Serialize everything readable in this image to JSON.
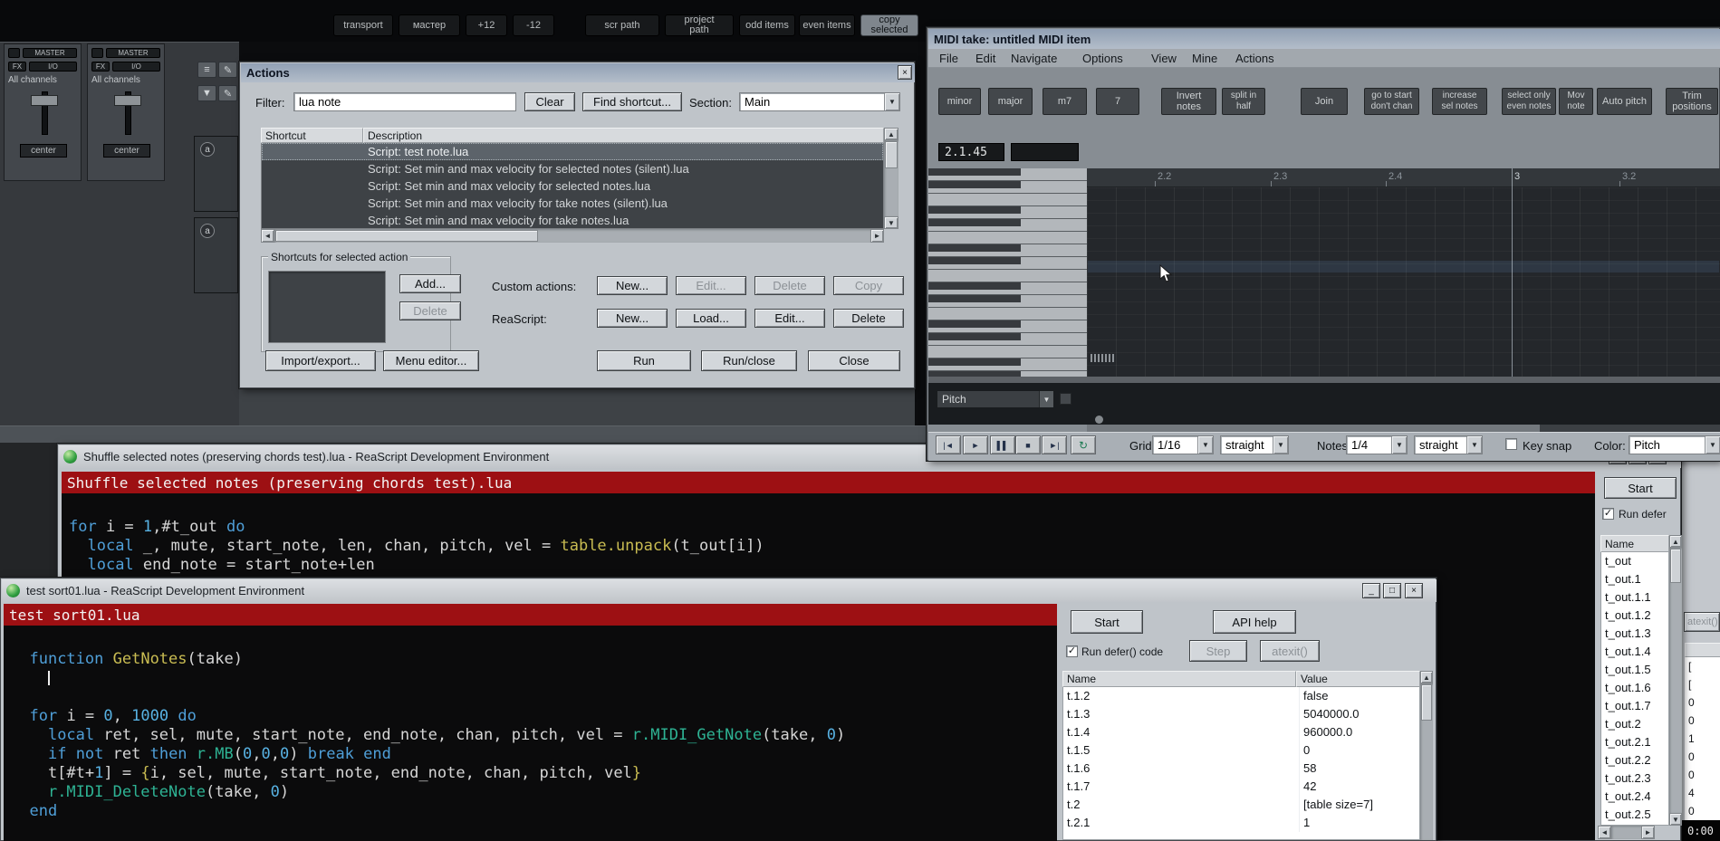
{
  "glyphs": {
    "up": "▲",
    "down": "▼",
    "left": "◄",
    "right": "►",
    "dd": "▼",
    "check": "✓",
    "min": "_",
    "max": "□",
    "close": "×"
  },
  "clock": "0:00",
  "main_toolbar": {
    "buttons": [
      {
        "l1": "transport",
        "l2": ""
      },
      {
        "l1": "мастер",
        "l2": ""
      },
      {
        "l1": "+12",
        "l2": ""
      },
      {
        "l1": "-12",
        "l2": ""
      },
      {
        "l1": "scr path",
        "l2": ""
      },
      {
        "l1": "project",
        "l2": "path"
      },
      {
        "l1": "odd items",
        "l2": ""
      },
      {
        "l1": "even items",
        "l2": ""
      },
      {
        "l1": "copy",
        "l2": "selected"
      }
    ]
  },
  "mixer": {
    "master_label": "MASTER",
    "fx_label": "FX",
    "io_label": "I/O",
    "channels_label": "All channels",
    "pan_label": "center",
    "track_badge": "a"
  },
  "docker_icons": {
    "list": "≡",
    "pencil": "✎",
    "filter": "▼"
  },
  "actions_dialog": {
    "title": "Actions",
    "filter_label": "Filter:",
    "filter_value": "lua note",
    "clear_button": "Clear",
    "find_shortcut_button": "Find shortcut...",
    "section_label": "Section:",
    "section_value": "Main",
    "col_shortcut": "Shortcut",
    "col_description": "Description",
    "rows": [
      "Script: test note.lua",
      "Script: Set min and max velocity for selected notes (silent).lua",
      "Script: Set min and max velocity for selected notes.lua",
      "Script: Set min and max velocity for take notes (silent).lua",
      "Script: Set min and max velocity for take notes.lua"
    ],
    "group_label": "Shortcuts for selected action",
    "add_button": "Add...",
    "delete_button": "Delete",
    "custom_label": "Custom actions:",
    "custom_new": "New...",
    "custom_edit": "Edit...",
    "custom_delete": "Delete",
    "custom_copy": "Copy",
    "reascript_label": "ReaScript:",
    "rs_new": "New...",
    "rs_load": "Load...",
    "rs_edit": "Edit...",
    "rs_delete": "Delete",
    "import_export": "Import/export...",
    "menu_editor": "Menu editor...",
    "run": "Run",
    "run_close": "Run/close",
    "close": "Close"
  },
  "midi_editor": {
    "title": "MIDI take: untitled MIDI item",
    "menus": [
      "File",
      "Edit",
      "Navigate",
      "Options",
      "View",
      "Mine",
      "Actions"
    ],
    "toolbar": [
      {
        "l1": "minor",
        "l2": ""
      },
      {
        "l1": "major",
        "l2": ""
      },
      {
        "l1": "m7",
        "l2": ""
      },
      {
        "l1": "7",
        "l2": ""
      },
      {
        "l1": "Invert",
        "l2": "notes"
      },
      {
        "l1": "split in half",
        "l2": ""
      },
      {
        "l1": "Join",
        "l2": ""
      },
      {
        "l1": "go to start",
        "l2": "don't chan"
      },
      {
        "l1": "increase",
        "l2": "sel notes"
      },
      {
        "l1": "select only",
        "l2": "even notes"
      },
      {
        "l1": "Mov note",
        "l2": ""
      },
      {
        "l1": "Auto pitch",
        "l2": ""
      },
      {
        "l1": "Trim",
        "l2": "positions"
      }
    ],
    "position": "2.1.45",
    "ruler": [
      "2.2",
      "2.3",
      "2.4",
      "3",
      "3.2"
    ],
    "cc_lane": "Pitch",
    "transport": [
      "|◄",
      "►",
      "▌▌",
      "■",
      "►|",
      "↻"
    ],
    "grid_label": "Grid:",
    "grid_value": "1/16",
    "grid_swing": "straight",
    "notes_label": "Notes:",
    "notes_value": "1/4",
    "notes_swing": "straight",
    "key_snap_label": "Key snap",
    "color_label": "Color:",
    "color_value": "Pitch"
  },
  "shuffle_ide": {
    "title": "Shuffle selected notes (preserving chords test).lua - ReaScript Development Environment",
    "doc_title": "Shuffle selected notes (preserving chords test).lua",
    "code": [
      {
        "tokens": []
      },
      {
        "tokens": [
          {
            "t": "for",
            "c": "kw"
          },
          {
            "t": " i = "
          },
          {
            "t": "1",
            "c": "num"
          },
          {
            "t": ",#t_out "
          },
          {
            "t": "do",
            "c": "kw"
          }
        ]
      },
      {
        "tokens": [
          {
            "t": "  "
          },
          {
            "t": "local",
            "c": "kw"
          },
          {
            "t": " _, mute, start_note, len, chan, pitch, vel = "
          },
          {
            "t": "table.unpack",
            "c": "fn"
          },
          {
            "t": "(t_out[i])"
          }
        ]
      },
      {
        "tokens": [
          {
            "t": "  "
          },
          {
            "t": "local",
            "c": "kw"
          },
          {
            "t": " end_note = start_note+len"
          }
        ]
      }
    ],
    "start_button": "Start",
    "run_defer_label": "Run defer",
    "name_header": "Name",
    "names": [
      "t_out",
      "t_out.1",
      "t_out.1.1",
      "t_out.1.2",
      "t_out.1.3",
      "t_out.1.4",
      "t_out.1.5",
      "t_out.1.6",
      "t_out.1.7",
      "t_out.2",
      "t_out.2.1",
      "t_out.2.2",
      "t_out.2.3",
      "t_out.2.4",
      "t_out.2.5"
    ]
  },
  "test_ide": {
    "title": "test sort01.lua - ReaScript Development Environment",
    "doc_title": "test sort01.lua",
    "code": [
      {
        "tokens": []
      },
      {
        "tokens": [
          {
            "t": "  "
          },
          {
            "t": "function",
            "c": "kw"
          },
          {
            "t": " "
          },
          {
            "t": "GetNotes",
            "c": "fn"
          },
          {
            "t": "(take)"
          }
        ]
      },
      {
        "tokens": [
          {
            "t": "    "
          }
        ],
        "caret": true
      },
      {
        "tokens": []
      },
      {
        "tokens": [
          {
            "t": "  "
          },
          {
            "t": "for",
            "c": "kw"
          },
          {
            "t": " i = "
          },
          {
            "t": "0",
            "c": "num"
          },
          {
            "t": ", "
          },
          {
            "t": "1000",
            "c": "num"
          },
          {
            "t": " "
          },
          {
            "t": "do",
            "c": "kw"
          }
        ]
      },
      {
        "tokens": [
          {
            "t": "    "
          },
          {
            "t": "local",
            "c": "kw"
          },
          {
            "t": " ret, sel, mute, start_note, end_note, chan, pitch, vel = "
          },
          {
            "t": "r.MIDI_GetNote",
            "c": "api"
          },
          {
            "t": "(take, "
          },
          {
            "t": "0",
            "c": "num"
          },
          {
            "t": ")"
          }
        ]
      },
      {
        "tokens": [
          {
            "t": "    "
          },
          {
            "t": "if",
            "c": "kw"
          },
          {
            "t": " "
          },
          {
            "t": "not",
            "c": "kw"
          },
          {
            "t": " ret "
          },
          {
            "t": "then",
            "c": "kw"
          },
          {
            "t": " "
          },
          {
            "t": "r.MB",
            "c": "api"
          },
          {
            "t": "("
          },
          {
            "t": "0",
            "c": "num"
          },
          {
            "t": ","
          },
          {
            "t": "0",
            "c": "num"
          },
          {
            "t": ","
          },
          {
            "t": "0",
            "c": "num"
          },
          {
            "t": ") "
          },
          {
            "t": "break",
            "c": "kw"
          },
          {
            "t": " "
          },
          {
            "t": "end",
            "c": "kw"
          }
        ]
      },
      {
        "tokens": [
          {
            "t": "    t[#t+"
          },
          {
            "t": "1",
            "c": "num"
          },
          {
            "t": "] = "
          },
          {
            "t": "{",
            "c": "fn"
          },
          {
            "t": "i, sel, mute, start_note, end_note, chan, pitch, vel"
          },
          {
            "t": "}",
            "c": "fn"
          }
        ]
      },
      {
        "tokens": [
          {
            "t": "    "
          },
          {
            "t": "r.MIDI_DeleteNote",
            "c": "api"
          },
          {
            "t": "(take, "
          },
          {
            "t": "0",
            "c": "num"
          },
          {
            "t": ")"
          }
        ]
      },
      {
        "tokens": [
          {
            "t": "  "
          },
          {
            "t": "end",
            "c": "kw"
          }
        ]
      }
    ],
    "start_button": "Start",
    "api_help_button": "API help",
    "run_defer_label": "Run defer() code",
    "step_button": "Step",
    "atexit_button": "atexit()",
    "col_name": "Name",
    "col_value": "Value",
    "vars": [
      {
        "n": "t.1.2",
        "v": "false"
      },
      {
        "n": "t.1.3",
        "v": "5040000.0"
      },
      {
        "n": "t.1.4",
        "v": "960000.0"
      },
      {
        "n": "t.1.5",
        "v": "0"
      },
      {
        "n": "t.1.6",
        "v": "58"
      },
      {
        "n": "t.1.7",
        "v": "42"
      },
      {
        "n": "t.2",
        "v": "[table size=7]"
      },
      {
        "n": "t.2.1",
        "v": "1"
      }
    ]
  },
  "fragment": {
    "atexit_button": "atexit()",
    "values": [
      "[",
      "[",
      "0",
      "0",
      "1",
      "0",
      "0",
      "4",
      "0"
    ]
  }
}
